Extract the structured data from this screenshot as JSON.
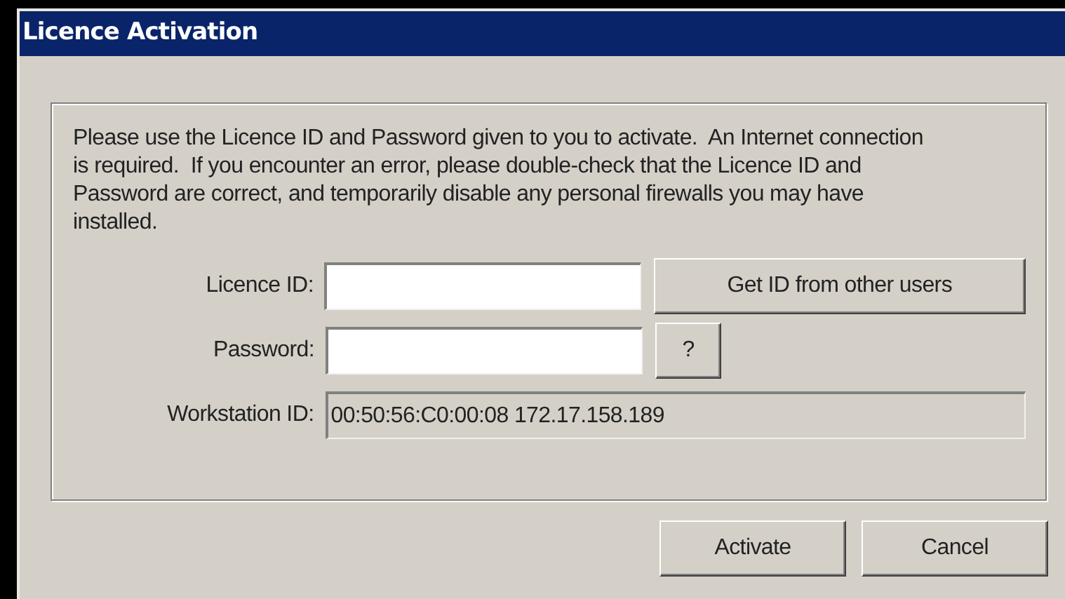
{
  "window": {
    "title": "Licence Activation"
  },
  "message": "Please use the Licence ID and Password given to you to activate.  An Internet connection is required.  If you encounter an error, please double-check that the Licence ID and Password are correct, and temporarily disable any personal firewalls you may have installed.",
  "fields": [
    {
      "label": "Licence ID:",
      "disabled": false,
      "button": "Get ID from other users"
    },
    {
      "label": "Password:",
      "disabled": false,
      "button": "?"
    },
    {
      "label": "Workstation ID:",
      "value": "00:50:56:C0:00:08 172.17.158.189",
      "disabled": true
    }
  ],
  "buttons": [
    "Activate",
    "Cancel"
  ]
}
